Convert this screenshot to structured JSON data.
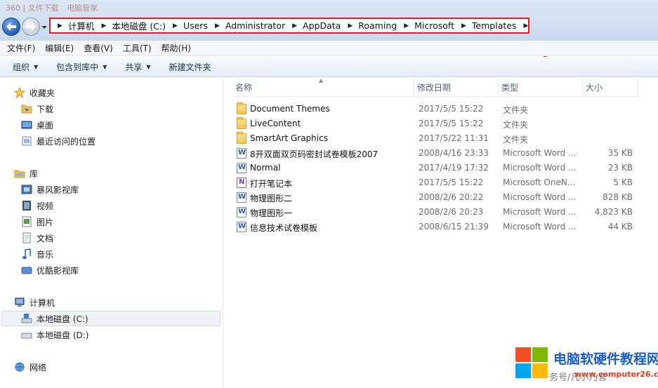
{
  "window": {
    "title_fragments": [
      "360 | 文件下载",
      "电脑管家"
    ]
  },
  "address": {
    "crumbs": [
      "计算机",
      "本地磁盘 (C:)",
      "Users",
      "Administrator",
      "AppData",
      "Roaming",
      "Microsoft",
      "Templates"
    ]
  },
  "menubar": {
    "items": [
      "文件(F)",
      "编辑(E)",
      "查看(V)",
      "工具(T)",
      "帮助(H)"
    ]
  },
  "toolbar": {
    "organize": "组织",
    "include_library": "包含到库中",
    "share": "共享",
    "new_folder": "新建文件夹"
  },
  "nav": {
    "favorites": "收藏夹",
    "downloads": "下载",
    "desktop": "桌面",
    "recent": "最近访问的位置",
    "libraries": "库",
    "storm": "暴风影视库",
    "videos": "视频",
    "pictures": "图片",
    "documents": "文档",
    "music": "音乐",
    "youku": "优酷影视库",
    "computer": "计算机",
    "drive_c": "本地磁盘 (C:)",
    "drive_d": "本地磁盘 (D:)",
    "network": "网络"
  },
  "columns": {
    "name": "名称",
    "date": "修改日期",
    "type": "类型",
    "size": "大小"
  },
  "files": [
    {
      "name": "Document Themes",
      "date": "2017/5/5 15:22",
      "type": "文件夹",
      "size": "",
      "icon": "folder-icon"
    },
    {
      "name": "LiveContent",
      "date": "2017/5/5 15:22",
      "type": "文件夹",
      "size": "",
      "icon": "folder-icon"
    },
    {
      "name": "SmartArt Graphics",
      "date": "2017/5/22 11:31",
      "type": "文件夹",
      "size": "",
      "icon": "folder-icon"
    },
    {
      "name": "8开双面双页码密封试卷模板2007",
      "date": "2008/4/16 23:33",
      "type": "Microsoft Word ...",
      "size": "35 KB",
      "icon": "word-doc-icon"
    },
    {
      "name": "Normal",
      "date": "2017/4/19 17:32",
      "type": "Microsoft Word ...",
      "size": "23 KB",
      "icon": "word-doc-icon"
    },
    {
      "name": "打开笔记本",
      "date": "2017/5/5 15:22",
      "type": "Microsoft OneN...",
      "size": "5 KB",
      "icon": "onenote-icon"
    },
    {
      "name": "物理图形二",
      "date": "2008/2/6 20:22",
      "type": "Microsoft Word ...",
      "size": "828 KB",
      "icon": "word-doc-icon"
    },
    {
      "name": "物理图形一",
      "date": "2008/2/6 20:23",
      "type": "Microsoft Word ...",
      "size": "4,823 KB",
      "icon": "word-doc-icon"
    },
    {
      "name": "信息技术试卷模板",
      "date": "2008/6/15 21:39",
      "type": "Microsoft Word ...",
      "size": "44 KB",
      "icon": "word-doc-icon"
    }
  ],
  "watermark": {
    "title": "电脑软硬件教程网",
    "url": "www.computer26.com",
    "side_text": "务号/凡小乃言"
  },
  "colors": {
    "highlight_border": "#e02020",
    "annotation_arrow": "#e02020",
    "brand_blue": "#1b5fc4"
  }
}
